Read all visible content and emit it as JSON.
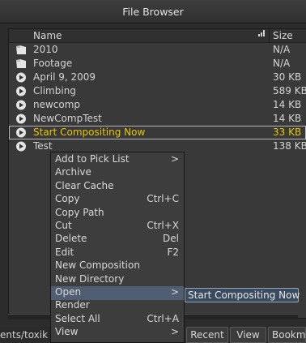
{
  "window": {
    "title": "File Browser"
  },
  "header": {
    "name": "Name",
    "size": "Size",
    "sort_icon": "sort-bars-icon"
  },
  "files": [
    {
      "name": "2010",
      "size": "N/A",
      "icon": "folder-icon"
    },
    {
      "name": "Footage",
      "size": "N/A",
      "icon": "folder-icon"
    },
    {
      "name": "April 9, 2009",
      "size": "30 KB",
      "icon": "composition-icon"
    },
    {
      "name": "Climbing",
      "size": "589 KB",
      "icon": "composition-icon"
    },
    {
      "name": "newcomp",
      "size": "14 KB",
      "icon": "composition-icon"
    },
    {
      "name": "NewCompTest",
      "size": "14 KB",
      "icon": "composition-icon"
    },
    {
      "name": "Start Compositing Now",
      "size": "33 KB",
      "icon": "composition-icon",
      "selected": true
    },
    {
      "name": "Test",
      "size": "138 KB",
      "icon": "composition-icon"
    }
  ],
  "context_menu": [
    {
      "label": "Add to Pick List",
      "shortcut": "",
      "submenu": true
    },
    {
      "label": "Archive",
      "shortcut": ""
    },
    {
      "label": "Clear Cache",
      "shortcut": ""
    },
    {
      "label": "Copy",
      "shortcut": "Ctrl+C"
    },
    {
      "label": "Copy Path",
      "shortcut": ""
    },
    {
      "label": "Cut",
      "shortcut": "Ctrl+X"
    },
    {
      "label": "Delete",
      "shortcut": "Del"
    },
    {
      "label": "Edit",
      "shortcut": "F2"
    },
    {
      "label": "New Composition",
      "shortcut": ""
    },
    {
      "label": "New Directory",
      "shortcut": ""
    },
    {
      "label": "Open",
      "shortcut": "",
      "submenu": true,
      "highlighted": true
    },
    {
      "label": "Render",
      "shortcut": ""
    },
    {
      "label": "Select All",
      "shortcut": "Ctrl+A"
    },
    {
      "label": "View",
      "shortcut": "",
      "submenu": true
    }
  ],
  "submenu": {
    "label": "Start Compositing Now"
  },
  "submenu_arrow": ">",
  "bottom": {
    "path": "ents/toxik",
    "buttons": [
      "Recent",
      "View",
      "Bookm"
    ]
  },
  "colors": {
    "selected_text": "#e8c800",
    "menu_highlight": "#4f5e73"
  }
}
